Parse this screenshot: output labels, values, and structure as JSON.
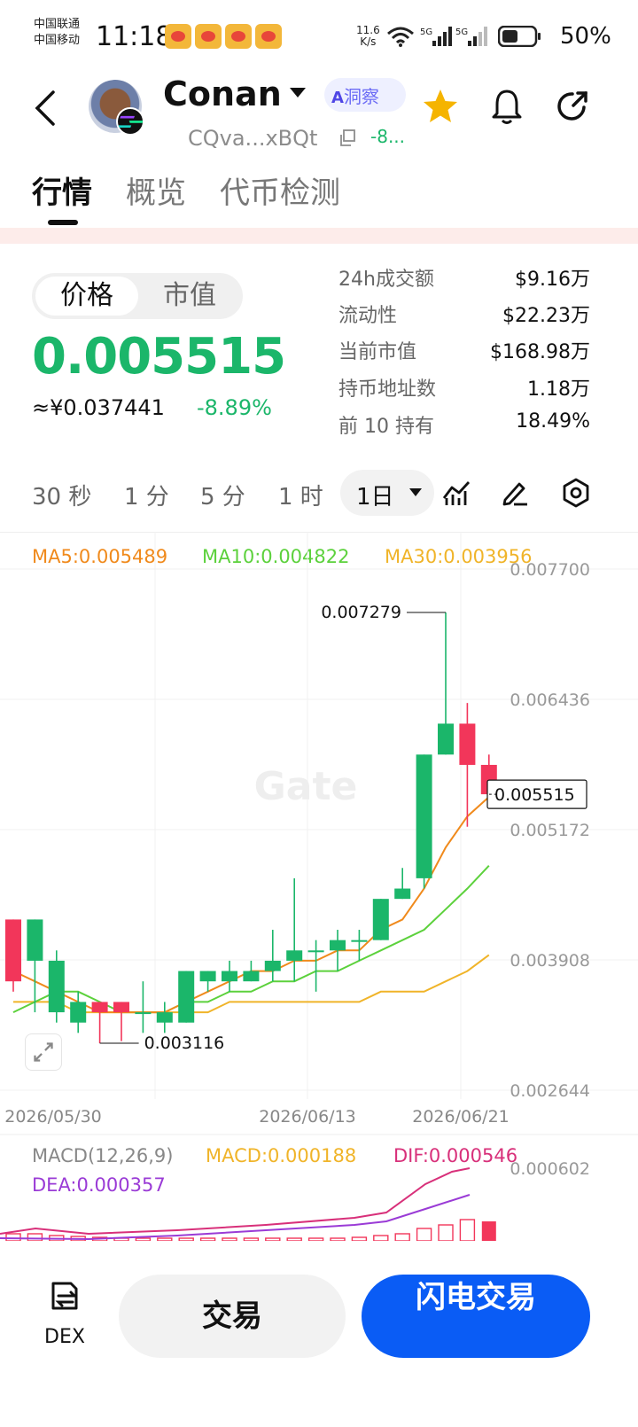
{
  "status_bar": {
    "carrier1": "中国联通",
    "carrier2": "中国移动",
    "time": "11:18",
    "net_speed_value": "11.6",
    "net_speed_unit": "K/s",
    "battery": "50%",
    "signal_labels": [
      "5G",
      "5G"
    ]
  },
  "header": {
    "coin_name": "Conan",
    "ai_label": "洞察",
    "ai_prefix": "A",
    "contract": "CQva...xBQt",
    "contract_change": "-8...",
    "favorite_color": "#f5b400"
  },
  "tabs": [
    "行情",
    "概览",
    "代币检测"
  ],
  "price_block": {
    "toggle": [
      "价格",
      "市值"
    ],
    "price": "0.005515",
    "price_cny": "≈¥0.037441",
    "change": "-8.89%",
    "stats": [
      {
        "label": "24h成交额",
        "value": "$9.16万"
      },
      {
        "label": "流动性",
        "value": "$22.23万"
      },
      {
        "label": "当前市值",
        "value": "$168.98万"
      },
      {
        "label": "持币地址数",
        "value": "1.18万"
      },
      {
        "label": "前 10 持有",
        "value": "18.49%"
      }
    ]
  },
  "timeframes": [
    "30 秒",
    "1 分",
    "5 分",
    "1 时"
  ],
  "timeframe_active": "1日",
  "chart": {
    "ma5": "MA5:0.005489",
    "ma10": "MA10:0.004822",
    "ma30": "MA30:0.003956",
    "macd_title": "MACD(12,26,9)",
    "macd_value": "MACD:0.000188",
    "dif": "DIF:0.000546",
    "dea": "DEA:0.000357",
    "watermark": "Gate",
    "high_label": "0.007279",
    "low_label": "0.003116",
    "current_label": "0.005515",
    "colors": {
      "up": "#1bb66a",
      "down": "#f2365a",
      "ma5": "#f08a1c",
      "ma10": "#5cd13c",
      "ma30": "#f0b429",
      "dif": "#d8307a",
      "dea": "#9a3bd6"
    }
  },
  "chart_data": {
    "type": "candlestick",
    "y_ticks": [
      "0.007700",
      "0.006436",
      "0.005172",
      "0.003908",
      "0.002644"
    ],
    "x_ticks": [
      "2026/05/30",
      "2026/06/13",
      "2026/06/21"
    ],
    "ylim": [
      0.002644,
      0.0077
    ],
    "macd_tick": "0.000602",
    "candles": [
      {
        "open": 0.0043,
        "close": 0.0037,
        "high": 0.0043,
        "low": 0.0036
      },
      {
        "open": 0.0039,
        "close": 0.0043,
        "high": 0.0043,
        "low": 0.0034
      },
      {
        "open": 0.0034,
        "close": 0.0039,
        "high": 0.004,
        "low": 0.0033
      },
      {
        "open": 0.0033,
        "close": 0.0035,
        "high": 0.0036,
        "low": 0.0032
      },
      {
        "open": 0.0035,
        "close": 0.0034,
        "high": 0.0035,
        "low": 0.0031
      },
      {
        "open": 0.0035,
        "close": 0.0034,
        "high": 0.0035,
        "low": 0.00312
      },
      {
        "open": 0.0034,
        "close": 0.0034,
        "high": 0.0037,
        "low": 0.0032
      },
      {
        "open": 0.0033,
        "close": 0.0034,
        "high": 0.0035,
        "low": 0.0032
      },
      {
        "open": 0.0033,
        "close": 0.0038,
        "high": 0.0038,
        "low": 0.0033
      },
      {
        "open": 0.0037,
        "close": 0.0038,
        "high": 0.0038,
        "low": 0.0036
      },
      {
        "open": 0.0037,
        "close": 0.0038,
        "high": 0.0039,
        "low": 0.0036
      },
      {
        "open": 0.0037,
        "close": 0.0038,
        "high": 0.0039,
        "low": 0.0037
      },
      {
        "open": 0.0038,
        "close": 0.0039,
        "high": 0.0042,
        "low": 0.0037
      },
      {
        "open": 0.0039,
        "close": 0.004,
        "high": 0.0047,
        "low": 0.0037
      },
      {
        "open": 0.004,
        "close": 0.004,
        "high": 0.0041,
        "low": 0.0036
      },
      {
        "open": 0.004,
        "close": 0.0041,
        "high": 0.0042,
        "low": 0.0038
      },
      {
        "open": 0.0041,
        "close": 0.0041,
        "high": 0.0042,
        "low": 0.0039
      },
      {
        "open": 0.0041,
        "close": 0.0045,
        "high": 0.0045,
        "low": 0.0041
      },
      {
        "open": 0.0045,
        "close": 0.0046,
        "high": 0.0048,
        "low": 0.0045
      },
      {
        "open": 0.0047,
        "close": 0.0059,
        "high": 0.0059,
        "low": 0.0046
      },
      {
        "open": 0.0059,
        "close": 0.0062,
        "high": 0.007279,
        "low": 0.0059
      },
      {
        "open": 0.0062,
        "close": 0.0058,
        "high": 0.0064,
        "low": 0.0052
      },
      {
        "open": 0.0058,
        "close": 0.005515,
        "high": 0.0059,
        "low": 0.0054
      }
    ],
    "ma5": [
      0.0038,
      0.0037,
      0.0036,
      0.0035,
      0.0034,
      0.0034,
      0.0034,
      0.0034,
      0.0035,
      0.0036,
      0.0037,
      0.0038,
      0.0038,
      0.0039,
      0.0039,
      0.004,
      0.004,
      0.0042,
      0.0043,
      0.0046,
      0.005,
      0.0053,
      0.005489
    ],
    "ma10": [
      0.0034,
      0.0035,
      0.0036,
      0.0036,
      0.0035,
      0.0034,
      0.0034,
      0.0034,
      0.0035,
      0.0035,
      0.0036,
      0.0036,
      0.0037,
      0.0037,
      0.0038,
      0.0038,
      0.0039,
      0.004,
      0.0041,
      0.0042,
      0.0044,
      0.0046,
      0.004822
    ],
    "ma30": [
      0.0035,
      0.0035,
      0.0035,
      0.0034,
      0.0034,
      0.0034,
      0.0034,
      0.0034,
      0.0034,
      0.0034,
      0.0035,
      0.0035,
      0.0035,
      0.0035,
      0.0035,
      0.0035,
      0.0035,
      0.0036,
      0.0036,
      0.0036,
      0.0037,
      0.0038,
      0.003956
    ]
  },
  "bottom_bar": {
    "dex_label": "DEX",
    "trade_label": "交易",
    "flash_label": "闪电交易"
  }
}
